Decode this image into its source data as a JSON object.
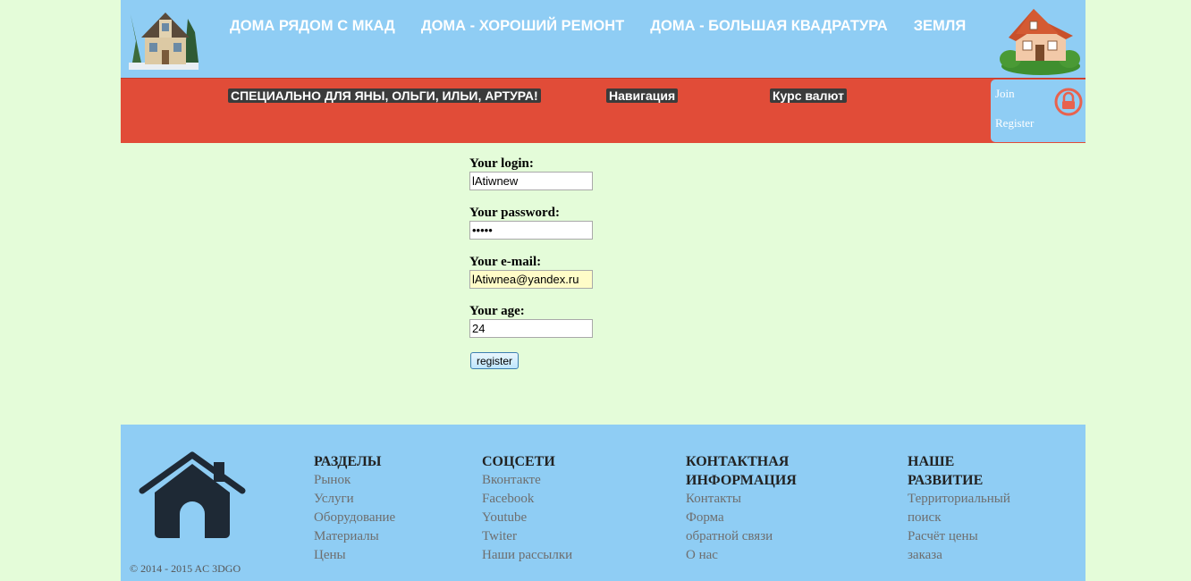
{
  "header": {
    "nav": [
      "ДОМА РЯДОМ С МКАД",
      "ДОМА - ХОРОШИЙ РЕМОНТ",
      "ДОМА - БОЛЬШАЯ КВАДРАТУРА",
      "ЗЕМЛЯ"
    ]
  },
  "redbar": {
    "special": "СПЕЦИАЛЬНО ДЛЯ ЯНЫ, ОЛЬГИ, ИЛЬИ, АРТУРА!",
    "navigation": "Навигация",
    "currency": "Курс валют"
  },
  "auth": {
    "join": "Join",
    "register": "Register"
  },
  "form": {
    "login_label": "Your login:",
    "login_value": "lAtiwnew",
    "password_label": "Your password:",
    "password_value": "•••••",
    "email_label": "Your e-mail:",
    "email_value": "lAtiwnea@yandex.ru",
    "age_label": "Your age:",
    "age_value": "24",
    "submit_label": "register"
  },
  "footer": {
    "copyright": "© 2014 - 2015 AC 3DGO",
    "sections": {
      "title": "РАЗДЕЛЫ",
      "links": [
        "Рынок",
        "Услуги",
        "Оборудование",
        "Материалы",
        "Цены"
      ]
    },
    "social": {
      "title": "СОЦСЕТИ",
      "links": [
        "Вконтакте",
        "Facebook",
        "Youtube",
        "Twiter",
        "Наши рассылки"
      ]
    },
    "contact": {
      "title_line1": "КОНТАКТНАЯ",
      "title_line2": "ИНФОРМАЦИЯ",
      "links": [
        "Контакты",
        "Форма",
        "обратной связи",
        "О нас"
      ]
    },
    "development": {
      "title_line1": "НАШЕ",
      "title_line2": "РАЗВИТИЕ",
      "links": [
        "Территориальный",
        "поиск",
        "Расчёт цены",
        "заказа"
      ]
    }
  },
  "colors": {
    "page_bg": "#e4fcd9",
    "header_bg": "#8fcdf4",
    "redbar_bg": "#e14c38",
    "lock_icon": "#e8624e"
  }
}
